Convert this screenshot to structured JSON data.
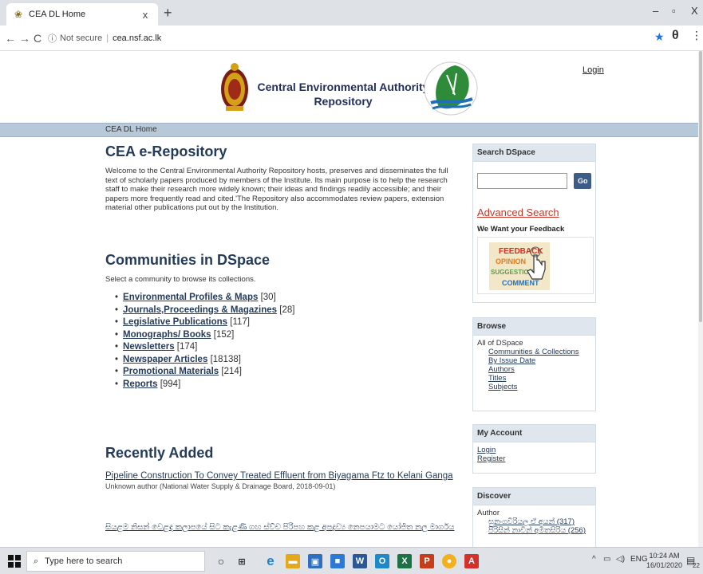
{
  "browser": {
    "tab_title": "CEA DL Home",
    "tab_close": "x",
    "new_tab": "+",
    "minimize": "–",
    "restore": "▫",
    "close": "X",
    "back": "←",
    "forward": "→",
    "reload": "C",
    "security_label": "Not secure",
    "url": "cea.nsf.ac.lk"
  },
  "header": {
    "title_line1": "Central Environmental Authority",
    "title_line2": "Repository",
    "login": "Login"
  },
  "breadcrumb": {
    "home": "CEA DL Home"
  },
  "intro": {
    "heading": "CEA e-Repository",
    "text": "Welcome to the Central Environmental Authority Repository hosts, preserves and disseminates the full text of scholarly papers produced by members of the Institute. Its main purpose is to help the research staff to make their research more widely known; their ideas and findings readily accessible; and their papers more frequently read and cited.'The Repository also accommodates review papers, extension material other publications put out by the Institution."
  },
  "communities": {
    "heading": "Communities in DSpace",
    "subtext": "Select a community to browse its collections.",
    "items": [
      {
        "label": "Environmental Profiles & Maps",
        "count": "[30]"
      },
      {
        "label": "Journals,Proceedings & Magazines",
        "count": "[28]"
      },
      {
        "label": "Legislative Publications",
        "count": "[117]"
      },
      {
        "label": "Monographs/ Books",
        "count": "[152]"
      },
      {
        "label": "Newsletters",
        "count": "[174]"
      },
      {
        "label": "Newspaper Articles",
        "count": "[18138]"
      },
      {
        "label": "Promotional Materials",
        "count": "[214]"
      },
      {
        "label": "Reports",
        "count": "[994]"
      }
    ]
  },
  "recent": {
    "heading": "Recently Added",
    "item1_title": "Pipeline Construction To Convey Treated Effluent from Biyagama Ftz to Kelani Ganga",
    "item1_meta": "Unknown author (National Water Supply & Drainage Board, 2018-09-01)",
    "item2_title": "සියළම නිසන් වෙළඳ කලාපයේ සිට කැළණි ගඟ ස්ව්ච පිරිපහ කළ අපද්‍රව්‍ය නෙපයාමට යෝජිත නල මාර්ගය"
  },
  "sidebar": {
    "search": {
      "heading": "Search DSpace",
      "go": "Go",
      "advanced": "Advanced Search",
      "feedback_title": "We Want your Feedback",
      "feedback_words": [
        "FEEDBACK",
        "OPINION",
        "SUGGESTION",
        "COMMENT"
      ]
    },
    "browse": {
      "heading": "Browse",
      "all": "All of DSpace",
      "links": [
        "Communities & Collections",
        "By Issue Date",
        "Authors",
        "Titles",
        "Subjects"
      ]
    },
    "account": {
      "heading": "My Account",
      "login": "Login",
      "register": "Register"
    },
    "discover": {
      "heading": "Discover",
      "author_label": "Author",
      "author1": "සුනංගවිරියල ඒ අයන් (317)",
      "author2": "පිරිසින් නාවින් අමිතසිරිය (256)"
    }
  },
  "taskbar": {
    "search_placeholder": "Type here to search",
    "lang": "ENG",
    "time": "10:24 AM",
    "date": "16/01/2020",
    "notif_count": "22"
  },
  "colors": {
    "accent": "#243b5a",
    "breadcrumb_bg": "#b7c9d9",
    "advanced_search": "#c0392b"
  }
}
